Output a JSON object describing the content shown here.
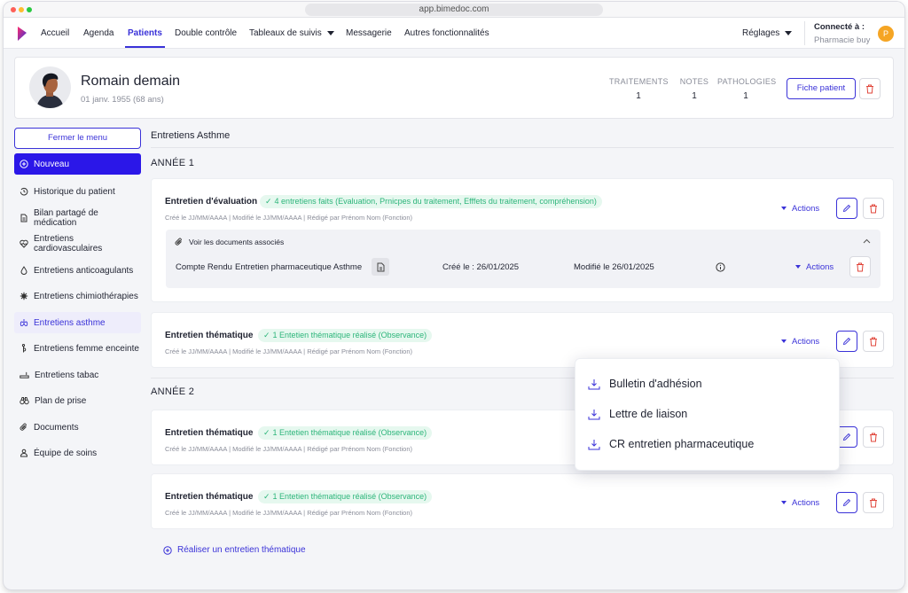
{
  "browser": {
    "url": "app.bimedoc.com"
  },
  "nav": {
    "items": [
      "Accueil",
      "Agenda",
      "Patients",
      "Double contrôle",
      "Tableaux de suivis",
      "Messagerie",
      "Autres fonctionnalités"
    ],
    "active": "Patients",
    "settings": "Réglages",
    "connected_label": "Connecté à :",
    "pharmacy": "Pharmacie buy",
    "user_initial": "P",
    "accent": "#3a32d8"
  },
  "patient": {
    "name": "Romain demain",
    "dob": "01 janv. 1955 (68 ans)",
    "stats": [
      {
        "label": "TRAITEMENTS",
        "value": "1"
      },
      {
        "label": "NOTES",
        "value": "1"
      },
      {
        "label": "PATHOLOGIES",
        "value": "1"
      }
    ],
    "fiche_button": "Fiche patient"
  },
  "sidebar": {
    "close_menu": "Fermer le menu",
    "new": "Nouveau",
    "items": [
      {
        "label": "Historique du patient",
        "icon": "history-icon"
      },
      {
        "label": "Bilan partagé de médication",
        "icon": "document-icon"
      },
      {
        "label": "Entretiens cardiovasculaires",
        "icon": "heart-pulse-icon"
      },
      {
        "label": "Entretiens anticoagulants",
        "icon": "drop-icon"
      },
      {
        "label": "Entretiens chimiothérapies",
        "icon": "virus-icon"
      },
      {
        "label": "Entretiens asthme",
        "icon": "lungs-icon",
        "active": true
      },
      {
        "label": "Entretiens femme enceinte",
        "icon": "pregnant-icon"
      },
      {
        "label": "Entretiens tabac",
        "icon": "cigarette-icon"
      },
      {
        "label": "Plan de prise",
        "icon": "binoculars-icon"
      },
      {
        "label": "Documents",
        "icon": "paperclip-icon"
      },
      {
        "label": "Équipe de soins",
        "icon": "team-icon"
      }
    ]
  },
  "main": {
    "title": "Entretiens Asthme",
    "year1": "ANNÉE 1",
    "year2": "ANNÉE 2",
    "meta": "Créé le JJ/MM/AAAA | Modifié le JJ/MM/AAAA | Rédigé par Prénom Nom (Fonction)",
    "actions_label": "Actions",
    "cards": [
      {
        "title": "Entretien d'évaluation",
        "badge": "4 entretiens faits (Evaluation, Prnicpes du traitement, Efffets du traitement, compréhension)"
      },
      {
        "title": "Entretien thématique",
        "badge": "1 Entetien thématique réalisé (Observance)"
      },
      {
        "title": "Entretien thématique",
        "badge": "1 Entetien thématique réalisé (Observance)"
      },
      {
        "title": "Entretien thématique",
        "badge": "1 Entetien thématique réalisé (Observance)"
      }
    ],
    "docs": {
      "link": "Voir les documents associés",
      "type": "Compte Rendu",
      "name": "Entretien pharmaceutique Asthme",
      "created": "Créé le : 26/01/2025",
      "modified": "Modifié le 26/01/2025"
    },
    "realiser": "Réaliser un entretien thématique"
  },
  "dropdown": {
    "items": [
      "Bulletin d'adhésion",
      "Lettre de liaison",
      "CR entretien pharmaceutique"
    ]
  }
}
